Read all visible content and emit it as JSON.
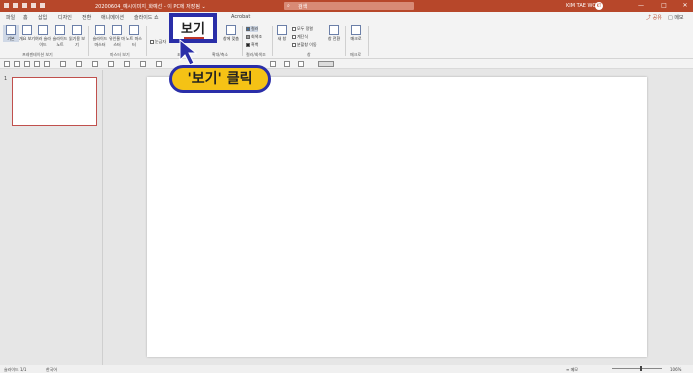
{
  "titlebar": {
    "doc_title": "20200604_예시이미지_화예선 - 이 PC에 저장됨 ⌄",
    "search_placeholder": "검색",
    "user_name": "KIM TAE WON",
    "avatar_initials": "KT",
    "minimize": "—",
    "maximize": "□",
    "close": "✕"
  },
  "tabs": [
    "파일",
    "홈",
    "삽입",
    "디자인",
    "전환",
    "애니메이션",
    "슬라이드 쇼",
    "Acrobat"
  ],
  "tabs_right": {
    "share": "⤴ 공유",
    "comments": "□ 메모"
  },
  "ribbon": {
    "presentation_views": [
      "기본",
      "개요 보기",
      "여러 슬라이드",
      "슬라이드 노트",
      "읽기용 보기"
    ],
    "presentation_views_label": "프레젠테이션 보기",
    "master_views": [
      "슬라이드 마스터",
      "유인물 마스터",
      "노트 마스터"
    ],
    "master_views_label": "마스터 보기",
    "show_label": "표시",
    "show_partial": "눈금자",
    "zoom_items": [
      "창에 맞춤"
    ],
    "zoom_label": "확대/축소",
    "color_items": [
      "컬러",
      "회색조",
      "흑백"
    ],
    "color_label": "컬러/회색조",
    "window_items": [
      "새 창",
      "모두 정렬",
      "계단식",
      "분할창 이동"
    ],
    "window_switch": "창 전환",
    "window_label": "창",
    "macro": "매크로",
    "macro_label": "매크로"
  },
  "callout": {
    "highlight_text": "보기",
    "pill_text": "'보기' 클릭"
  },
  "thumbnail": {
    "number": "1"
  },
  "statusbar": {
    "slide_info": "슬라이드 1/1",
    "language": "한국어",
    "notes": "≡ 메모",
    "zoom": "106%"
  },
  "colors": {
    "accent": "#b7472a",
    "callout_border": "#2a2ea8",
    "pill_fill": "#f5c215"
  }
}
